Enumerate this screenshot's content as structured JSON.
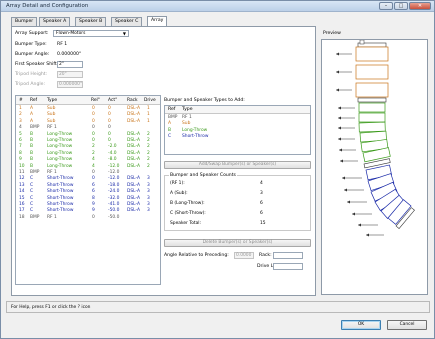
{
  "window": {
    "title": "Array Detail and Configuration",
    "minimize": "–",
    "maximize": "□",
    "close": "✕"
  },
  "tabs": [
    {
      "label": "Bumper"
    },
    {
      "label": "Speaker A"
    },
    {
      "label": "Speaker B"
    },
    {
      "label": "Speaker C"
    },
    {
      "label": "Array"
    }
  ],
  "array": {
    "support_label": "Array Support:",
    "support_value": "Flown-Motors",
    "bumper_type_label": "Bumper Type:",
    "bumper_type_value": "RF 1",
    "bumper_angle_label": "Bumper Angle:",
    "bumper_angle_value": "0.000000°",
    "first_shift_label": "First Speaker Shift:",
    "first_shift_value": "2\"",
    "tripod_height_label": "Tripod Height:",
    "tripod_height_value": "20\"",
    "tripod_angle_label": "Tripod Angle:",
    "tripod_angle_value": "0.000000°"
  },
  "grid": {
    "headers": [
      "#",
      "Ref",
      "Type",
      "Rel°",
      "Act°",
      "Rack",
      "Drive"
    ],
    "rows": [
      {
        "n": "1",
        "ref": "A",
        "type": "Sub",
        "rel": "0",
        "act": "0",
        "rack": "DSL-A",
        "drive": "1",
        "color": "orange"
      },
      {
        "n": "2",
        "ref": "A",
        "type": "Sub",
        "rel": "0",
        "act": "0",
        "rack": "DSL-A",
        "drive": "1",
        "color": "orange"
      },
      {
        "n": "3",
        "ref": "A",
        "type": "Sub",
        "rel": "0",
        "act": "0",
        "rack": "DSL-A",
        "drive": "1",
        "color": "orange"
      },
      {
        "n": "4",
        "ref": "BMP",
        "type": "RF 1",
        "rel": "0",
        "act": "0",
        "rack": "",
        "drive": "",
        "color": "grey"
      },
      {
        "n": "5",
        "ref": "B",
        "type": "Long-Throw",
        "rel": "0",
        "act": "0",
        "rack": "DSL-A",
        "drive": "2",
        "color": "green"
      },
      {
        "n": "6",
        "ref": "B",
        "type": "Long-Throw",
        "rel": "0",
        "act": "0",
        "rack": "DSL-A",
        "drive": "2",
        "color": "green"
      },
      {
        "n": "7",
        "ref": "B",
        "type": "Long-Throw",
        "rel": "2",
        "act": "-2.0",
        "rack": "DSL-A",
        "drive": "2",
        "color": "green"
      },
      {
        "n": "8",
        "ref": "B",
        "type": "Long-Throw",
        "rel": "2",
        "act": "-4.0",
        "rack": "DSL-A",
        "drive": "2",
        "color": "green"
      },
      {
        "n": "9",
        "ref": "B",
        "type": "Long-Throw",
        "rel": "4",
        "act": "-8.0",
        "rack": "DSL-A",
        "drive": "2",
        "color": "green"
      },
      {
        "n": "10",
        "ref": "B",
        "type": "Long-Throw",
        "rel": "4",
        "act": "-12.0",
        "rack": "DSL-A",
        "drive": "2",
        "color": "green"
      },
      {
        "n": "11",
        "ref": "BMP",
        "type": "RF 1",
        "rel": "0",
        "act": "-12.0",
        "rack": "",
        "drive": "",
        "color": "grey"
      },
      {
        "n": "12",
        "ref": "C",
        "type": "Short-Throw",
        "rel": "0",
        "act": "-12.0",
        "rack": "DSL-A",
        "drive": "3",
        "color": "blue"
      },
      {
        "n": "13",
        "ref": "C",
        "type": "Short-Throw",
        "rel": "6",
        "act": "-18.0",
        "rack": "DSL-A",
        "drive": "3",
        "color": "blue"
      },
      {
        "n": "14",
        "ref": "C",
        "type": "Short-Throw",
        "rel": "6",
        "act": "-24.0",
        "rack": "DSL-A",
        "drive": "3",
        "color": "blue"
      },
      {
        "n": "15",
        "ref": "C",
        "type": "Short-Throw",
        "rel": "8",
        "act": "-32.0",
        "rack": "DSL-A",
        "drive": "3",
        "color": "blue"
      },
      {
        "n": "16",
        "ref": "C",
        "type": "Short-Throw",
        "rel": "9",
        "act": "-41.0",
        "rack": "DSL-A",
        "drive": "3",
        "color": "blue"
      },
      {
        "n": "17",
        "ref": "C",
        "type": "Short-Throw",
        "rel": "9",
        "act": "-50.0",
        "rack": "DSL-A",
        "drive": "3",
        "color": "blue"
      },
      {
        "n": "18",
        "ref": "BMP",
        "type": "RF 1",
        "rel": "0",
        "act": "-50.0",
        "rack": "",
        "drive": "",
        "color": "grey"
      }
    ]
  },
  "types_to_add": {
    "title": "Bumper and Speaker Types to Add:",
    "headers": [
      "Ref",
      "Type"
    ],
    "rows": [
      {
        "ref": "BMP",
        "type": "RF 1",
        "color": "grey"
      },
      {
        "ref": "A",
        "type": "Sub",
        "color": "orange"
      },
      {
        "ref": "B",
        "type": "Long-Throw",
        "color": "green"
      },
      {
        "ref": "C",
        "type": "Short-Throw",
        "color": "blue"
      }
    ]
  },
  "add_swap_button": "Add/Swap Bumper(s) or Speaker(s)",
  "counts": {
    "title": "Bumper and Speaker Counts",
    "rows": [
      {
        "label": "(RF 1):",
        "value": "4"
      },
      {
        "label": "A (Sub):",
        "value": "3"
      },
      {
        "label": "B (Long-Throw):",
        "value": "6"
      },
      {
        "label": "C (Short-Throw):",
        "value": "6"
      },
      {
        "label": "Speaker Total:",
        "value": "15"
      }
    ]
  },
  "delete_button": "Delete Bumper(s) or Speaker(s)",
  "angle_rel_label": "Angle Relative to Preceding:",
  "angle_rel_value": "0.0000",
  "rack_label": "Rack:",
  "drive_line_label": "Drive Line:",
  "preview": {
    "title": "Preview"
  },
  "status": {
    "text": "For Help, press F1 or click the ? icon"
  },
  "footer": {
    "ok": "OK",
    "cancel": "Cancel"
  },
  "colors": {
    "orange": "#c9741a",
    "green": "#3a9a1a",
    "blue": "#1a2aa8",
    "grey": "#555555"
  }
}
